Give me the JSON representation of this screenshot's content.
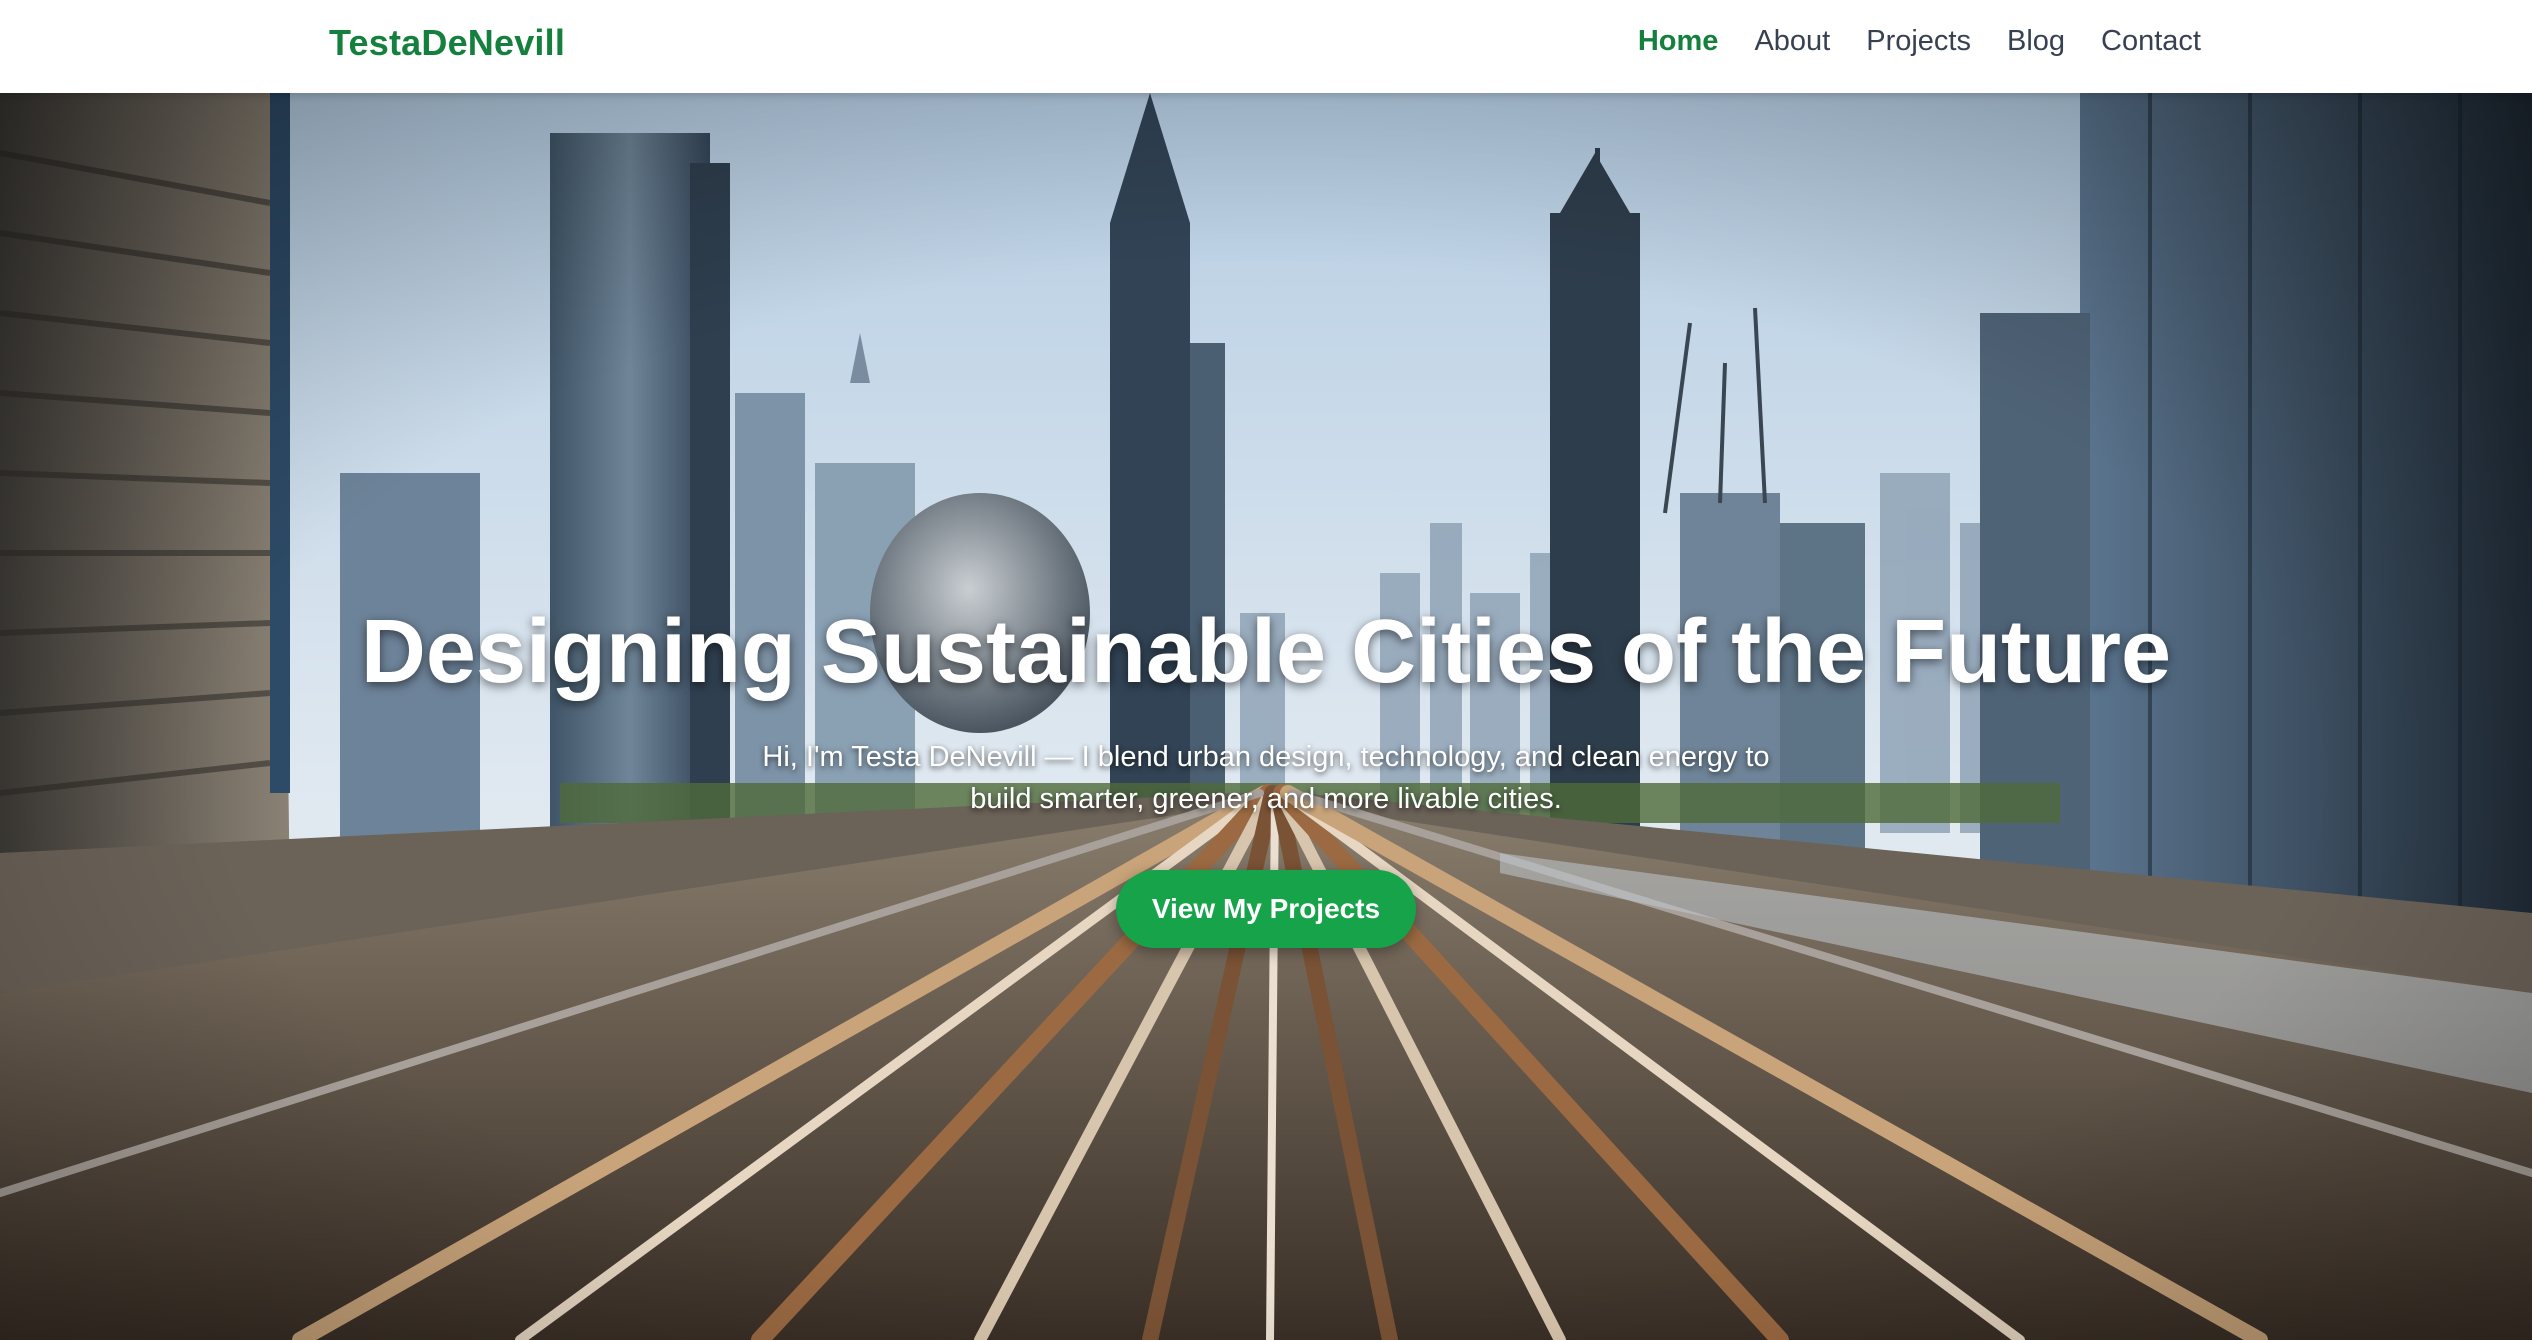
{
  "brand": "TestaDeNevill",
  "nav": {
    "items": [
      {
        "label": "Home",
        "active": true
      },
      {
        "label": "About",
        "active": false
      },
      {
        "label": "Projects",
        "active": false
      },
      {
        "label": "Blog",
        "active": false
      },
      {
        "label": "Contact",
        "active": false
      }
    ]
  },
  "hero": {
    "title": "Designing Sustainable Cities of the Future",
    "subtitle": "Hi, I'm Testa DeNevill — I blend urban design, technology, and clean energy to build smarter, greener, and more livable cities.",
    "cta_label": "View My Projects",
    "background": "city-skyline-metro-tracks-image"
  },
  "colors": {
    "accent": "#15803d",
    "cta": "#16a34a",
    "nav_text": "#374151"
  }
}
